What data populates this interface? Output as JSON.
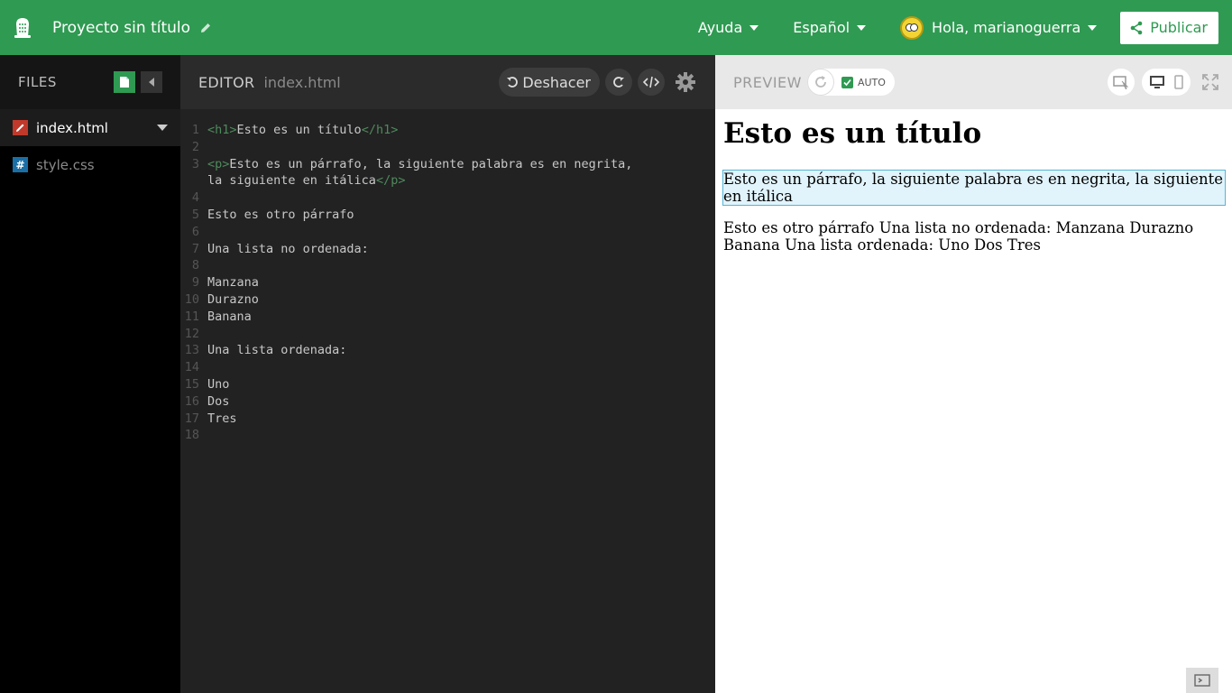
{
  "topbar": {
    "project_title": "Proyecto sin título",
    "help_label": "Ayuda",
    "language_label": "Español",
    "user_greeting": "Hola, marianoguerra",
    "publish_label": "Publicar"
  },
  "files": {
    "title": "FILES",
    "items": [
      {
        "name": "index.html",
        "icon": "html-file-icon",
        "active": true
      },
      {
        "name": "style.css",
        "icon": "css-file-icon",
        "active": false
      }
    ]
  },
  "editor": {
    "title": "EDITOR",
    "current_file": "index.html",
    "undo_label": "Deshacer",
    "lines": [
      {
        "n": "1",
        "text": "<h1>Esto es un título</h1>"
      },
      {
        "n": "2",
        "text": ""
      },
      {
        "n": "3",
        "text": "<p>Esto es un párrafo, la siguiente palabra es en negrita,"
      },
      {
        "n": "",
        "text": "la siguiente en itálica</p>"
      },
      {
        "n": "4",
        "text": ""
      },
      {
        "n": "5",
        "text": "Esto es otro párrafo"
      },
      {
        "n": "6",
        "text": ""
      },
      {
        "n": "7",
        "text": "Una lista no ordenada:"
      },
      {
        "n": "8",
        "text": ""
      },
      {
        "n": "9",
        "text": "Manzana"
      },
      {
        "n": "10",
        "text": "Durazno"
      },
      {
        "n": "11",
        "text": "Banana"
      },
      {
        "n": "12",
        "text": ""
      },
      {
        "n": "13",
        "text": "Una lista ordenada:"
      },
      {
        "n": "14",
        "text": ""
      },
      {
        "n": "15",
        "text": "Uno"
      },
      {
        "n": "16",
        "text": "Dos"
      },
      {
        "n": "17",
        "text": "Tres"
      },
      {
        "n": "18",
        "text": ""
      }
    ]
  },
  "preview": {
    "title": "PREVIEW",
    "auto_label": "AUTO",
    "heading": "Esto es un título",
    "paragraph1": "Esto es un párrafo, la siguiente palabra es en negrita, la siguiente en itálica",
    "paragraph2": "Esto es otro párrafo Una lista no ordenada: Manzana Durazno Banana Una lista ordenada: Uno Dos Tres"
  },
  "colors": {
    "brand": "#2f9a52",
    "editor_bg": "#222222",
    "tag": "#4e8a5c",
    "highlight": "#e1f3fb"
  }
}
